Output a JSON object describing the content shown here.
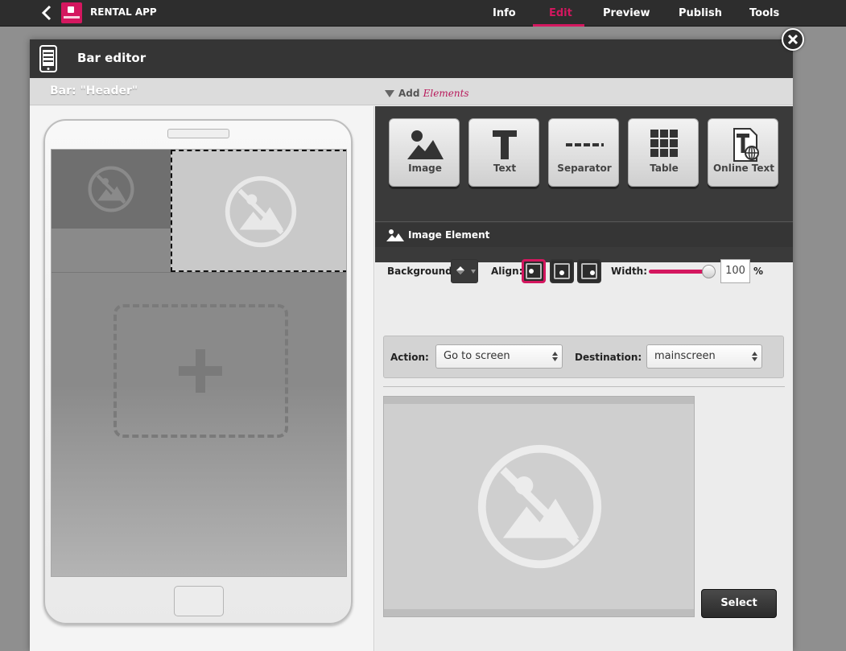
{
  "topbar": {
    "app_name": "RENTAL APP",
    "nav": [
      "Info",
      "Edit",
      "Preview",
      "Publish",
      "Tools"
    ],
    "active_tab": "Edit",
    "accent_color": "#d4175f"
  },
  "dialog": {
    "title": "Bar editor",
    "bar_label": "Bar: \"Header\"",
    "add_prefix": "Add",
    "add_emphasis": "Elements"
  },
  "tools": [
    {
      "label": "Image",
      "icon": "image-icon"
    },
    {
      "label": "Text",
      "icon": "text-icon"
    },
    {
      "label": "Separator",
      "icon": "separator-icon"
    },
    {
      "label": "Table",
      "icon": "table-icon"
    },
    {
      "label": "Online Text",
      "icon": "online-text-icon"
    }
  ],
  "element": {
    "header": "Image Element",
    "background_label": "Background:",
    "align_label": "Align:",
    "width_label": "Width:",
    "width_value": "100",
    "width_unit": "%",
    "action_label": "Action:",
    "action_value": "Go to screen",
    "destination_label": "Destination:",
    "destination_value": "mainscreen",
    "select_button": "Select"
  }
}
